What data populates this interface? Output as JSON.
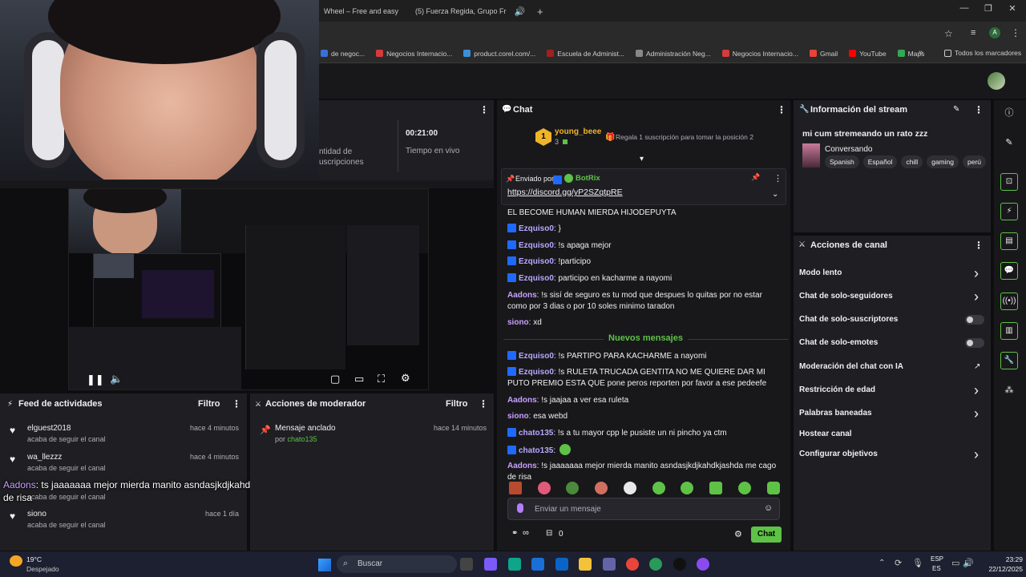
{
  "browser": {
    "tabs": [
      {
        "label": "Wheel – Free and easy"
      },
      {
        "label": "(5) Fuerza Regida, Grupo Fr"
      }
    ],
    "new_tab": "+",
    "bookmarks": [
      {
        "label": "de negoc...",
        "color": "#3a6fd8"
      },
      {
        "label": "Negocios Internacio...",
        "color": "#d83a3a"
      },
      {
        "label": "product.corel.com/...",
        "color": "#3a8fd8"
      },
      {
        "label": "Escuela de Administ...",
        "color": "#a02020"
      },
      {
        "label": "Administración Neg...",
        "color": "#888888"
      },
      {
        "label": "Negocios Internacio...",
        "color": "#d83a3a"
      },
      {
        "label": "Gmail",
        "color": "#ea4335"
      },
      {
        "label": "YouTube",
        "color": "#ff0000"
      },
      {
        "label": "Maps",
        "color": "#34a853"
      }
    ],
    "all_bookmarks": "Todos los marcadores"
  },
  "stats": {
    "time_value": "00:21:00",
    "time_label": "Tiempo en vivo",
    "subs_label_1": "ntidad de",
    "subs_label_2": "uscripciones"
  },
  "activity_feed": {
    "title": "Feed de actividades",
    "filter": "Filtro",
    "items": [
      {
        "name": "elguest2018",
        "sub": "acaba de seguir el canal",
        "time": "hace 4 minutos"
      },
      {
        "name": "wa_llezzz",
        "sub": "acaba de seguir el canal",
        "time": "hace 4 minutos"
      },
      {
        "name": "",
        "sub": "acaba de seguir el canal",
        "time": ""
      },
      {
        "name": "siono",
        "sub": "acaba de seguir el canal",
        "time": "hace 1 día"
      }
    ]
  },
  "overlay": {
    "user": "Aadons",
    "text": ": ts jaaaaaaa mejor mierda manito asndasjkdjkahdkjashda me cago de risa"
  },
  "mod_actions": {
    "title": "Acciones de moderador",
    "filter": "Filtro",
    "item_title": "Mensaje anclado",
    "item_by_prefix": "por",
    "item_by": "chato135",
    "item_time": "hace 14 minutos"
  },
  "chat": {
    "title": "Chat",
    "top_user": "young_beee",
    "top_rank": "1",
    "top_count": "3",
    "gift_prompt": "Regala 1 suscripción para tomar la posición 2",
    "pinned_prefix": "Enviado por",
    "pinned_user": "BotRix",
    "pinned_link": "https://discord.gg/yP2SZqtpRE",
    "new_messages": "Nuevos mensajes",
    "messages": [
      {
        "user": "",
        "text": "EL BECOME HUMAN MIERDA HIJODEPUYTA",
        "color": "#efeff1",
        "badge": false
      },
      {
        "user": "Ezquiso0",
        "text": ": }",
        "color": "#b8a8ff",
        "badge": true
      },
      {
        "user": "Ezquiso0",
        "text": ": !s apaga mejor",
        "color": "#b8a8ff",
        "badge": true
      },
      {
        "user": "Ezquiso0",
        "text": ": !participo",
        "color": "#b8a8ff",
        "badge": true
      },
      {
        "user": "Ezquiso0",
        "text": ": participo en kacharme a nayomi",
        "color": "#b8a8ff",
        "badge": true
      },
      {
        "user": "Aadons",
        "text": ": !s sisí de seguro es tu mod que despues lo quitas por no estar como por 3 dias o por 10 soles minimo taradon",
        "color": "#c8a0ff",
        "badge": false
      },
      {
        "user": "siono",
        "text": ": xd",
        "color": "#c8a0ff",
        "badge": false
      },
      {
        "user": "Ezquiso0",
        "text": ": !s PARTIPO PARA KACHARME a nayomi",
        "color": "#b8a8ff",
        "badge": true
      },
      {
        "user": "Ezquiso0",
        "text": ": !s RULETA TRUCADA GENTITA NO ME QUIERE DAR MI PUTO PREMIO ESTA QUE pone peros reporten por favor a ese pedeefe",
        "color": "#b8a8ff",
        "badge": true
      },
      {
        "user": "Aadons",
        "text": ": !s jaajaa a ver esa ruleta",
        "color": "#c8a0ff",
        "badge": false
      },
      {
        "user": "siono",
        "text": ": esa webd",
        "color": "#c8a0ff",
        "badge": false
      },
      {
        "user": "chato135",
        "text": ": !s a tu mayor cpp le pusiste un ni pincho ya ctm",
        "color": "#b8a8ff",
        "badge": true
      },
      {
        "user": "chato135",
        "text": ":",
        "color": "#b8a8ff",
        "badge": true
      },
      {
        "user": "Aadons",
        "text": ": !s jaaaaaaa mejor mierda manito asndasjkdjkahdkjashda me cago de risa",
        "color": "#c8a0ff",
        "badge": false
      }
    ],
    "input_placeholder": "Enviar un mensaje",
    "points_count": "0",
    "send_label": "Chat"
  },
  "stream_info": {
    "title": "Información del stream",
    "stream_title": "mi cum stremeando un rato zzz",
    "category": "Conversando",
    "tags": [
      "Spanish",
      "Español",
      "chill",
      "gaming",
      "perú"
    ]
  },
  "channel_actions": {
    "title": "Acciones de canal",
    "items": [
      {
        "label": "Modo lento",
        "control": "chevron"
      },
      {
        "label": "Chat de solo-seguidores",
        "control": "chevron"
      },
      {
        "label": "Chat de solo-suscriptores",
        "control": "toggle"
      },
      {
        "label": "Chat de solo-emotes",
        "control": "toggle"
      },
      {
        "label": "Moderación del chat con IA",
        "control": "external"
      },
      {
        "label": "Restricción de edad",
        "control": "chevron"
      },
      {
        "label": "Palabras baneadas",
        "control": "chevron"
      },
      {
        "label": "Hostear canal",
        "control": "none"
      },
      {
        "label": "Configurar objetivos",
        "control": "chevron"
      }
    ]
  },
  "taskbar": {
    "weather_temp": "19°C",
    "weather_desc": "Despejado",
    "search": "Buscar",
    "lang_1": "ESP",
    "lang_2": "ES",
    "time": "23:29",
    "date": "22/12/2025"
  },
  "colors": {
    "accent": "#5ec247",
    "twitch_purple": "#9146ff",
    "bg": "#0e0e10"
  }
}
